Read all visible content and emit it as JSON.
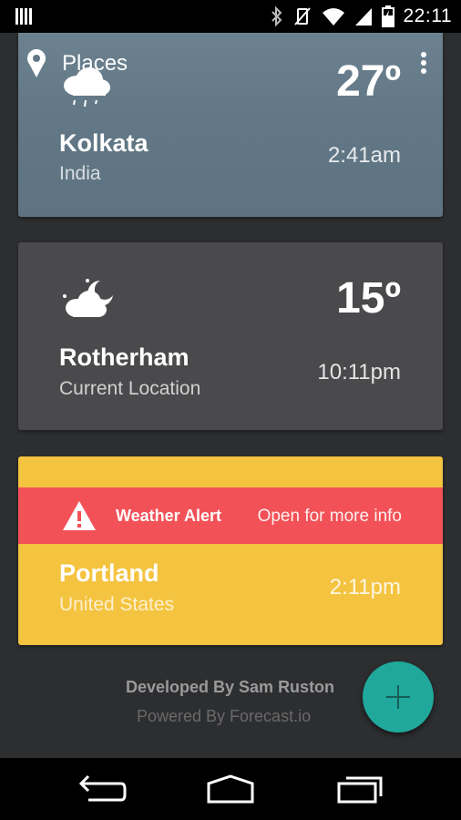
{
  "status_bar": {
    "time": "22:11",
    "icons": [
      "bars-icon",
      "bluetooth-icon",
      "vibrate-off-icon",
      "wifi-icon",
      "signal-icon",
      "battery-charging-icon"
    ]
  },
  "toolbar": {
    "title": "Places",
    "icons": [
      "location-pin-icon",
      "overflow-menu-icon"
    ]
  },
  "places": [
    {
      "city": "Kolkata",
      "country": "India",
      "temperature": "27º",
      "local_time": "2:41am",
      "icon": "rain-cloud-icon",
      "card_color": "#627886"
    },
    {
      "city": "Rotherham",
      "country": "Current Location",
      "temperature": "15º",
      "local_time": "10:11pm",
      "icon": "partly-cloudy-night-icon",
      "card_color": "#4a4a4c"
    },
    {
      "city": "Portland",
      "country": "United States",
      "local_time": "2:11pm",
      "card_color": "#f4c33f",
      "alert": {
        "title": "Weather Alert",
        "action": "Open for more info",
        "icon": "warning-icon",
        "color": "#f25157"
      }
    }
  ],
  "footer": {
    "developer": "Developed By Sam Ruston",
    "powered_by": "Powered By Forecast.io"
  },
  "fab": {
    "icon": "plus-icon",
    "color": "#1fa89b"
  },
  "nav_bar": {
    "icons": [
      "back-icon",
      "home-icon",
      "recent-apps-icon"
    ]
  }
}
